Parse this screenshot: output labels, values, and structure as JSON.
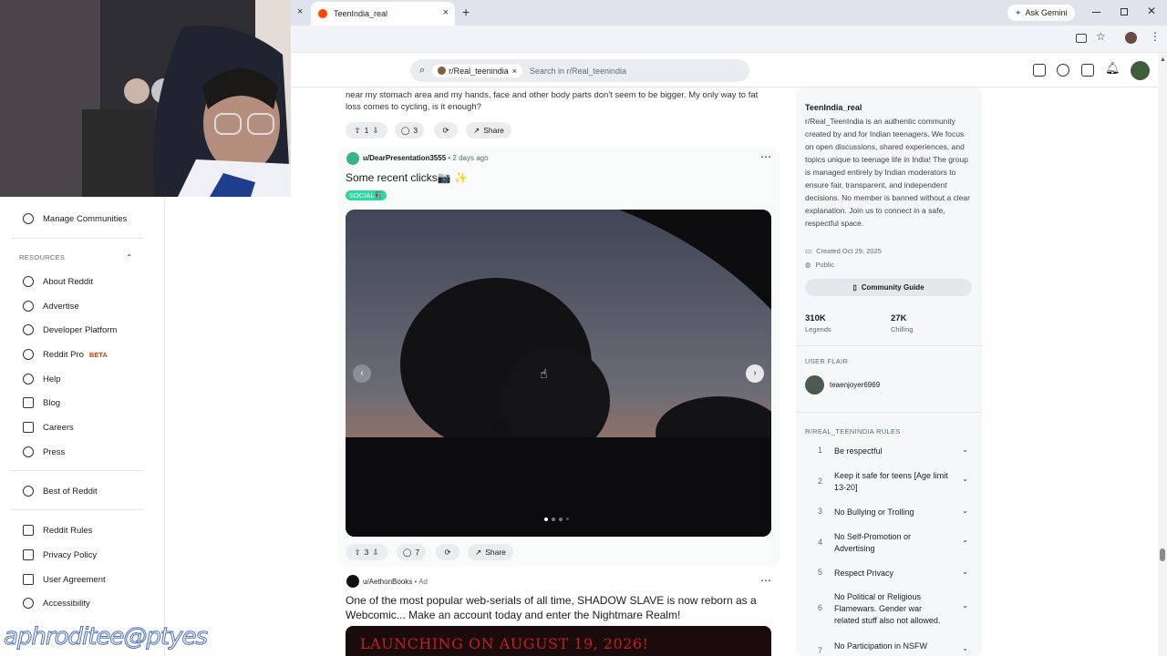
{
  "browser": {
    "tab_title": "TeenIndia_real",
    "new_tab": "+",
    "ask_gemini": "Ask Gemini",
    "close_tab": "×"
  },
  "header": {
    "subreddit_chip": "r/Real_teenindia",
    "search_placeholder": "Search in r/Real_teenindia"
  },
  "leftnav": {
    "manage_communities": "Manage Communities",
    "resources_title": "RESOURCES",
    "items": [
      "About Reddit",
      "Advertise",
      "Developer Platform",
      "Reddit Pro",
      "Help",
      "Blog",
      "Careers",
      "Press"
    ],
    "beta_badge": "BETA",
    "best_of": "Best of Reddit",
    "footer_items": [
      "Reddit Rules",
      "Privacy Policy",
      "User Agreement",
      "Accessibility"
    ]
  },
  "feed": {
    "post1": {
      "text": "near my stomach area and my hands, face and other body parts don't seem to be bigger. My only way to fat loss comes to cycling, is it enough?",
      "upvotes": "1",
      "comments": "3",
      "share": "Share"
    },
    "post2": {
      "author": "u/DearPresentation3555",
      "time": "2 days ago",
      "title": "Some recent clicks📷 ✨",
      "flair": "SOCIAL👫",
      "upvotes": "3",
      "comments": "7",
      "share": "Share"
    },
    "post3": {
      "author": "u/AethonBooks",
      "ad_label": "Ad",
      "title": "One of the most popular web-serials of all time, SHADOW SLAVE is now reborn as a Webcomic... Make an account today and enter the Nightmare Realm!",
      "banner_text": "LAUNCHING ON AUGUST 19, 2026!"
    }
  },
  "sidebar": {
    "name": "TeenIndia_real",
    "description": "r/Real_TeenIndia is an authentic community created by and for Indian teenagers. We focus on open discussions, shared experiences, and topics unique to teenage life in India! The group is managed entirely by Indian moderators to ensure fair, transparent, and independent decisions. No member is banned without a clear explanation. Join us to connect in a safe, respectful space.",
    "created": "Created Oct 29, 2025",
    "visibility": "Public",
    "guide_button": "Community Guide",
    "members": "310K",
    "members_label": "Legends",
    "online": "27K",
    "online_label": "Chilling",
    "user_flair_title": "USER FLAIR",
    "user_flair_name": "teaenjoyer6969",
    "rules_title": "R/REAL_TEENINDIA RULES",
    "rules": [
      {
        "num": "1",
        "text": "Be respectful"
      },
      {
        "num": "2",
        "text": "Keep it safe for teens [Age limit 13-20]"
      },
      {
        "num": "3",
        "text": "No Bullying or Trolling"
      },
      {
        "num": "4",
        "text": "No Self-Promotion or Advertising"
      },
      {
        "num": "5",
        "text": "Respect Privacy"
      },
      {
        "num": "6",
        "text": "No Political or Religious Flamewars. Gender war related stuff also not allowed."
      },
      {
        "num": "7",
        "text": "No Participation in NSFW"
      }
    ]
  },
  "watermark": "aphroditee@ptyes"
}
